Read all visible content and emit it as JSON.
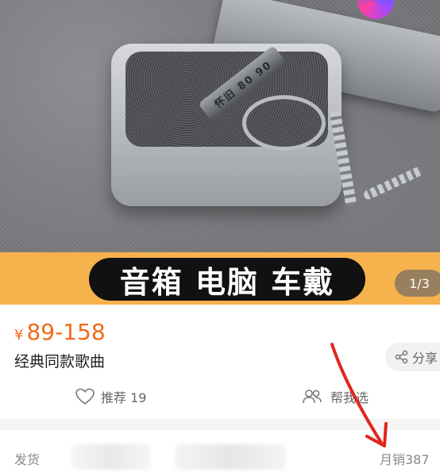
{
  "banner": {
    "text": "音箱 电脑 车戴",
    "page_indicator": "1/3"
  },
  "product": {
    "engraving": "怀旧 80 90",
    "currency": "¥",
    "price_range": "89-158",
    "title": "经典同款歌曲"
  },
  "actions": {
    "share_label": "分享",
    "recommend_label": "推荐 19",
    "help_choose_label": "帮我选"
  },
  "shipping": {
    "label": "发货",
    "monthly_sales": "月销387"
  },
  "colors": {
    "price": "#f06a1a",
    "banner": "#f6b24d",
    "annotation": "#e0261c"
  }
}
